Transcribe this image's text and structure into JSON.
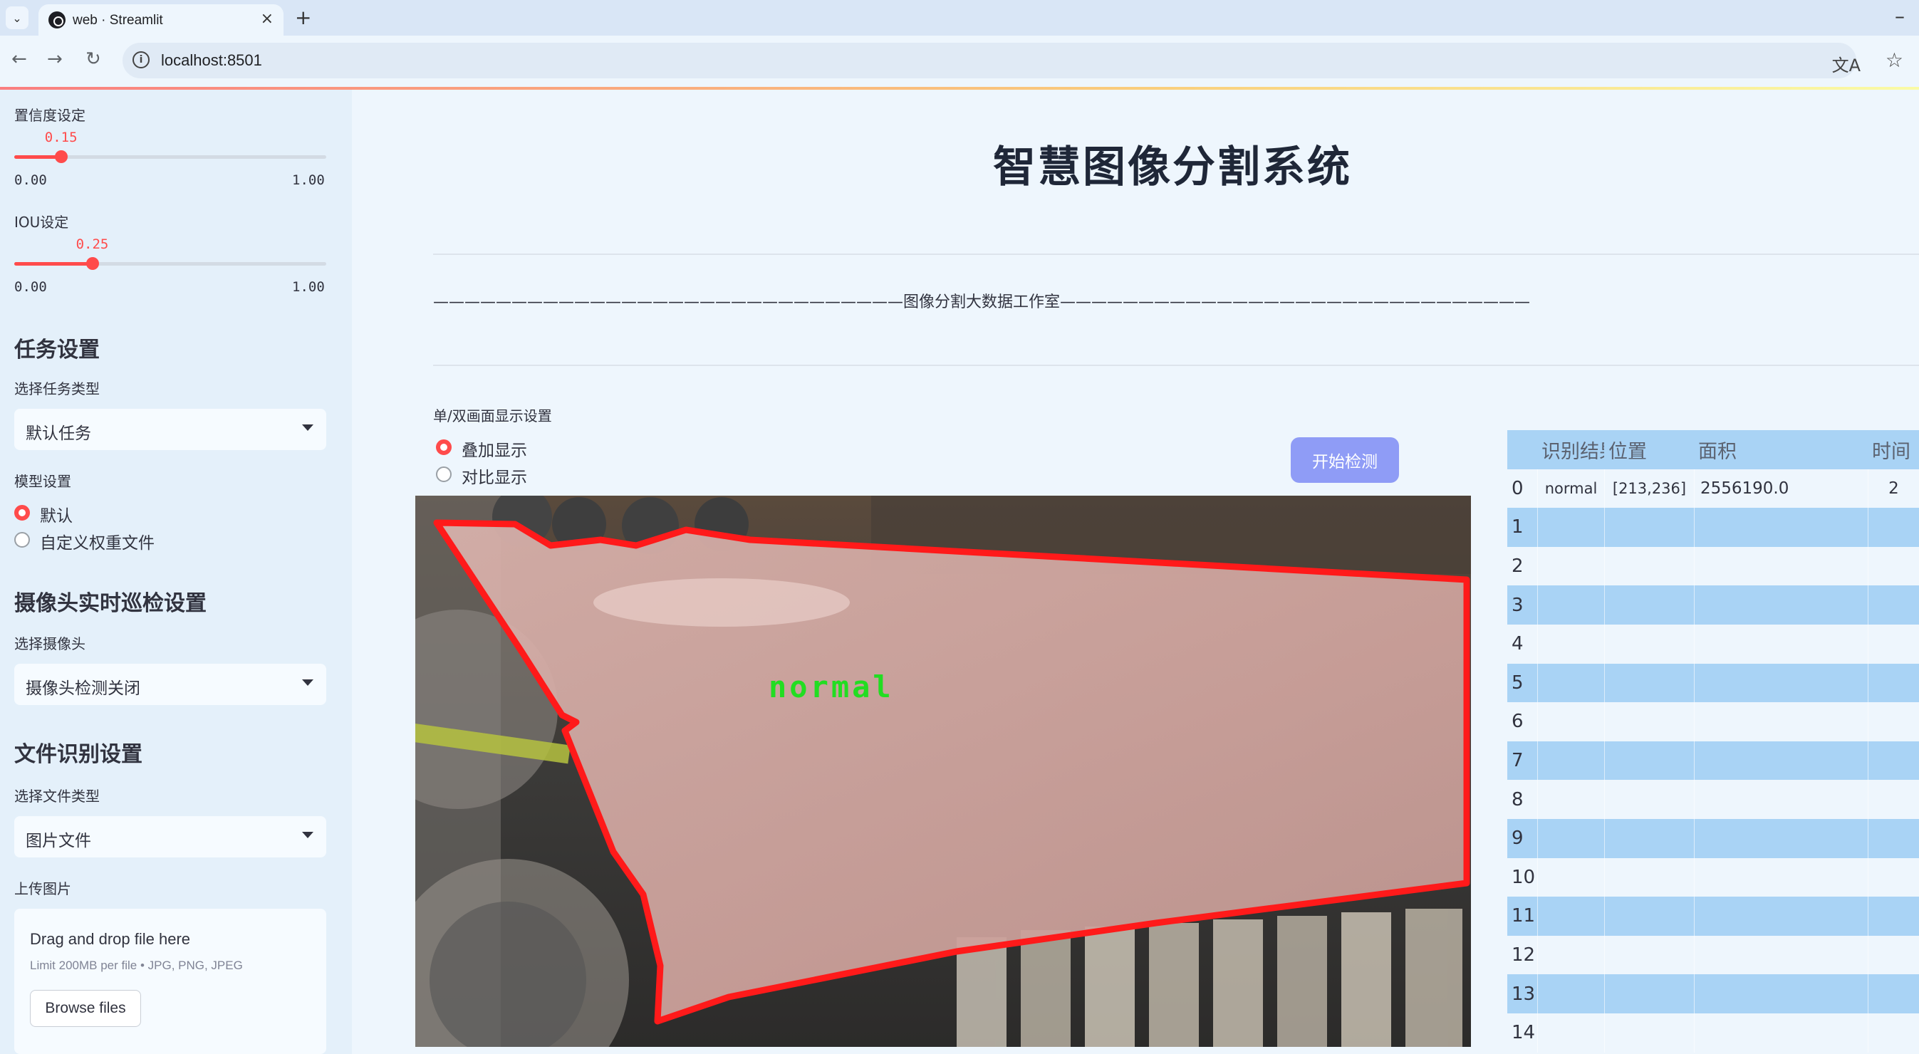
{
  "browser": {
    "tab_title": "web · Streamlit",
    "tab_close": "×",
    "new_tab": "+",
    "minimize": "–",
    "url": "localhost:8501",
    "nav": {
      "back": "←",
      "forward": "→",
      "reload": "↻"
    },
    "icons": {
      "site_info": "info-icon",
      "translate": "translate-icon",
      "bookmark": "star-icon"
    }
  },
  "sidebar": {
    "confidence": {
      "label": "置信度设定",
      "value": "0.15",
      "min": "0.00",
      "max": "1.00",
      "fraction": 0.15
    },
    "iou": {
      "label": "IOU设定",
      "value": "0.25",
      "min": "0.00",
      "max": "1.00",
      "fraction": 0.25
    },
    "task_settings": {
      "heading": "任务设置",
      "select_label": "选择任务类型",
      "selected": "默认任务"
    },
    "model_settings": {
      "label": "模型设置",
      "options": [
        "默认",
        "自定义权重文件"
      ],
      "selected_index": 0
    },
    "camera_settings": {
      "heading": "摄像头实时巡检设置",
      "select_label": "选择摄像头",
      "selected": "摄像头检测关闭"
    },
    "file_settings": {
      "heading": "文件识别设置",
      "select_label": "选择文件类型",
      "selected": "图片文件"
    },
    "upload": {
      "label": "上传图片",
      "title": "Drag and drop file here",
      "limit": "Limit 200MB per file • JPG, PNG, JPEG",
      "button": "Browse files"
    }
  },
  "main": {
    "title": "智慧图像分割系统",
    "banner": "——————————————————————————————图像分割大数据工作室——————————————————————————————",
    "display_mode": {
      "label": "单/双画面显示设置",
      "options": [
        "叠加显示",
        "对比显示"
      ],
      "selected_index": 0
    },
    "start_button": "开始检测",
    "detection_label": "normal",
    "colors": {
      "mask_outline": "#ff1a1a",
      "mask_fill": "#d6a8a3",
      "label_text": "#22dd22",
      "accent": "#ff4b4b"
    }
  },
  "results_table": {
    "columns": [
      "",
      "识别结果",
      "位置",
      "面积",
      "时间"
    ],
    "rows": [
      {
        "index": "0",
        "result": "normal",
        "position": "[213,236]",
        "area": "2556190.0",
        "time": "2"
      },
      {
        "index": "1",
        "result": "",
        "position": "",
        "area": "",
        "time": ""
      },
      {
        "index": "2",
        "result": "",
        "position": "",
        "area": "",
        "time": ""
      },
      {
        "index": "3",
        "result": "",
        "position": "",
        "area": "",
        "time": ""
      },
      {
        "index": "4",
        "result": "",
        "position": "",
        "area": "",
        "time": ""
      },
      {
        "index": "5",
        "result": "",
        "position": "",
        "area": "",
        "time": ""
      },
      {
        "index": "6",
        "result": "",
        "position": "",
        "area": "",
        "time": ""
      },
      {
        "index": "7",
        "result": "",
        "position": "",
        "area": "",
        "time": ""
      },
      {
        "index": "8",
        "result": "",
        "position": "",
        "area": "",
        "time": ""
      },
      {
        "index": "9",
        "result": "",
        "position": "",
        "area": "",
        "time": ""
      },
      {
        "index": "10",
        "result": "",
        "position": "",
        "area": "",
        "time": ""
      },
      {
        "index": "11",
        "result": "",
        "position": "",
        "area": "",
        "time": ""
      },
      {
        "index": "12",
        "result": "",
        "position": "",
        "area": "",
        "time": ""
      },
      {
        "index": "13",
        "result": "",
        "position": "",
        "area": "",
        "time": ""
      },
      {
        "index": "14",
        "result": "",
        "position": "",
        "area": "",
        "time": ""
      }
    ],
    "colors": {
      "header": "#a9d3f5",
      "stripe": "#a9d3f5",
      "plain": "#eef6fd"
    }
  }
}
